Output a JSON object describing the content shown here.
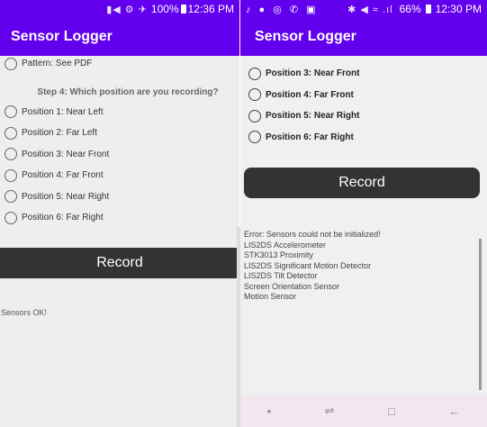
{
  "left": {
    "status_bar": {
      "icons": "▮◀ ⚙ ✈",
      "battery_text": "100%",
      "time": "12:36 PM"
    },
    "app_title": "Sensor Logger",
    "pattern_option": "Pattern: See PDF",
    "step_label": "Step 4: Which position are you recording?",
    "positions": [
      "Position 1: Near Left",
      "Position 2: Far Left",
      "Position 3: Near Front",
      "Position 4: Far Front",
      "Position 5: Near Right",
      "Position 6: Far Right"
    ],
    "record_label": "Record",
    "sensor_status": "Sensors OK!"
  },
  "right": {
    "status_bar": {
      "left_icons": "♪ ● ◎ ✆ ▣",
      "right_icons": "✱ ◀ ≈ .ıl",
      "battery_text": "66%",
      "time": "12:30 PM"
    },
    "app_title": "Sensor Logger",
    "positions": [
      "Position 3: Near Front",
      "Position 4: Far Front",
      "Position 5: Near Right",
      "Position 6: Far Right"
    ],
    "record_label": "Record",
    "error_lines": [
      "Error: Sensors could not be initialized!",
      "LIS2DS Accelerometer",
      "STK3013 Proximity",
      "LIS2DS Significant Motion Detector",
      "LIS2DS Tilt Detector",
      "Screen Orientation Sensor",
      "Motion Sensor"
    ],
    "nav": {
      "dot": "•",
      "recents": "⇌",
      "home": "□",
      "back": "←"
    }
  }
}
